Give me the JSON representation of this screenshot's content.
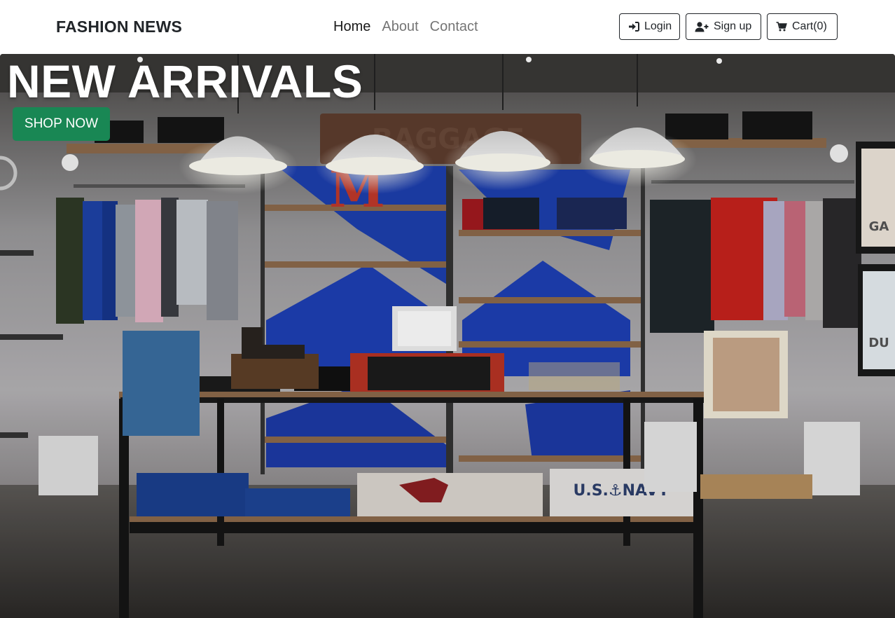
{
  "navbar": {
    "brand": "FASHION NEWS",
    "links": [
      {
        "label": "Home",
        "active": true
      },
      {
        "label": "About",
        "active": false
      },
      {
        "label": "Contact",
        "active": false
      }
    ],
    "buttons": {
      "login": {
        "label": "Login",
        "icon": "sign-in-icon"
      },
      "signup": {
        "label": "Sign up",
        "icon": "user-plus-icon"
      },
      "cart": {
        "label": "Cart(0)",
        "icon": "shopping-cart-icon"
      }
    }
  },
  "hero": {
    "title": "NEW ARRIVALS",
    "cta_label": "SHOP NOW",
    "cta_color": "#198754",
    "image": "clothing-store-interior",
    "signage": [
      "M",
      "GA",
      "DU",
      "U.S. NAVY"
    ]
  }
}
